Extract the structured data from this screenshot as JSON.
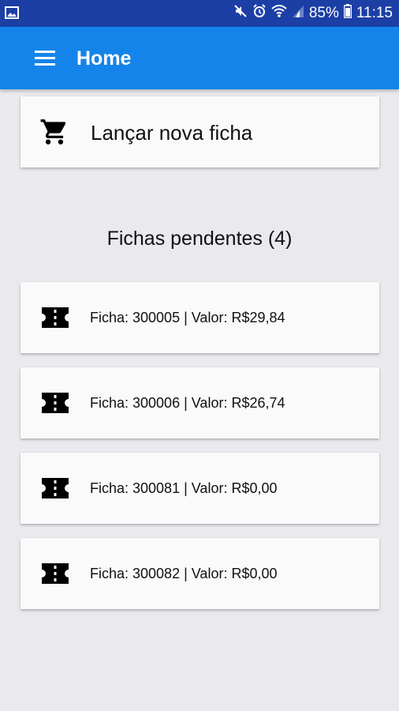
{
  "status_bar": {
    "battery_percent": "85%",
    "time": "11:15"
  },
  "app_bar": {
    "title": "Home",
    "menu_icon": "hamburger-menu-icon"
  },
  "new_entry": {
    "label": "Lançar nova ficha",
    "icon": "shopping-cart-icon"
  },
  "pending": {
    "title": "Fichas pendentes (4)",
    "items": [
      {
        "label": "Ficha: 300005 | Valor: R$29,84"
      },
      {
        "label": "Ficha: 300006 | Valor: R$26,74"
      },
      {
        "label": "Ficha: 300081 | Valor: R$0,00"
      },
      {
        "label": "Ficha: 300082 | Valor: R$0,00"
      }
    ]
  },
  "colors": {
    "status_bar": "#1c3fa6",
    "app_bar": "#1584ea",
    "background": "#e9e9ee",
    "card": "#fafafa"
  }
}
